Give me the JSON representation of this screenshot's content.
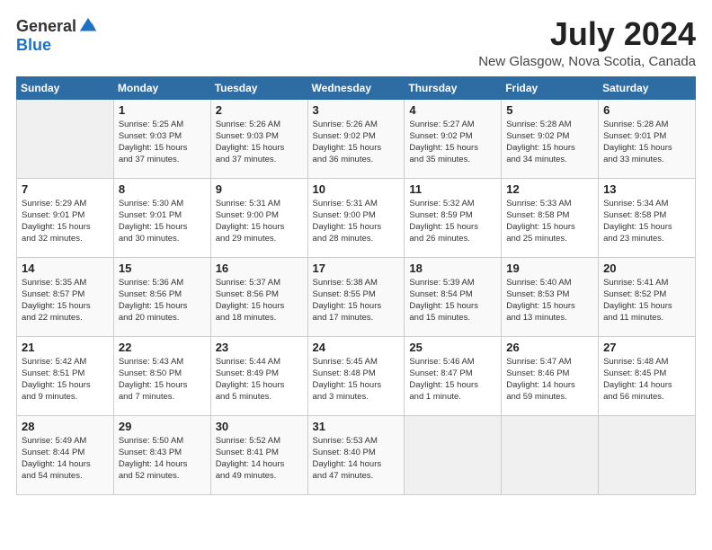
{
  "logo": {
    "general": "General",
    "blue": "Blue"
  },
  "title": "July 2024",
  "location": "New Glasgow, Nova Scotia, Canada",
  "weekdays": [
    "Sunday",
    "Monday",
    "Tuesday",
    "Wednesday",
    "Thursday",
    "Friday",
    "Saturday"
  ],
  "weeks": [
    [
      {
        "day": "",
        "info": ""
      },
      {
        "day": "1",
        "info": "Sunrise: 5:25 AM\nSunset: 9:03 PM\nDaylight: 15 hours\nand 37 minutes."
      },
      {
        "day": "2",
        "info": "Sunrise: 5:26 AM\nSunset: 9:03 PM\nDaylight: 15 hours\nand 37 minutes."
      },
      {
        "day": "3",
        "info": "Sunrise: 5:26 AM\nSunset: 9:02 PM\nDaylight: 15 hours\nand 36 minutes."
      },
      {
        "day": "4",
        "info": "Sunrise: 5:27 AM\nSunset: 9:02 PM\nDaylight: 15 hours\nand 35 minutes."
      },
      {
        "day": "5",
        "info": "Sunrise: 5:28 AM\nSunset: 9:02 PM\nDaylight: 15 hours\nand 34 minutes."
      },
      {
        "day": "6",
        "info": "Sunrise: 5:28 AM\nSunset: 9:01 PM\nDaylight: 15 hours\nand 33 minutes."
      }
    ],
    [
      {
        "day": "7",
        "info": "Sunrise: 5:29 AM\nSunset: 9:01 PM\nDaylight: 15 hours\nand 32 minutes."
      },
      {
        "day": "8",
        "info": "Sunrise: 5:30 AM\nSunset: 9:01 PM\nDaylight: 15 hours\nand 30 minutes."
      },
      {
        "day": "9",
        "info": "Sunrise: 5:31 AM\nSunset: 9:00 PM\nDaylight: 15 hours\nand 29 minutes."
      },
      {
        "day": "10",
        "info": "Sunrise: 5:31 AM\nSunset: 9:00 PM\nDaylight: 15 hours\nand 28 minutes."
      },
      {
        "day": "11",
        "info": "Sunrise: 5:32 AM\nSunset: 8:59 PM\nDaylight: 15 hours\nand 26 minutes."
      },
      {
        "day": "12",
        "info": "Sunrise: 5:33 AM\nSunset: 8:58 PM\nDaylight: 15 hours\nand 25 minutes."
      },
      {
        "day": "13",
        "info": "Sunrise: 5:34 AM\nSunset: 8:58 PM\nDaylight: 15 hours\nand 23 minutes."
      }
    ],
    [
      {
        "day": "14",
        "info": "Sunrise: 5:35 AM\nSunset: 8:57 PM\nDaylight: 15 hours\nand 22 minutes."
      },
      {
        "day": "15",
        "info": "Sunrise: 5:36 AM\nSunset: 8:56 PM\nDaylight: 15 hours\nand 20 minutes."
      },
      {
        "day": "16",
        "info": "Sunrise: 5:37 AM\nSunset: 8:56 PM\nDaylight: 15 hours\nand 18 minutes."
      },
      {
        "day": "17",
        "info": "Sunrise: 5:38 AM\nSunset: 8:55 PM\nDaylight: 15 hours\nand 17 minutes."
      },
      {
        "day": "18",
        "info": "Sunrise: 5:39 AM\nSunset: 8:54 PM\nDaylight: 15 hours\nand 15 minutes."
      },
      {
        "day": "19",
        "info": "Sunrise: 5:40 AM\nSunset: 8:53 PM\nDaylight: 15 hours\nand 13 minutes."
      },
      {
        "day": "20",
        "info": "Sunrise: 5:41 AM\nSunset: 8:52 PM\nDaylight: 15 hours\nand 11 minutes."
      }
    ],
    [
      {
        "day": "21",
        "info": "Sunrise: 5:42 AM\nSunset: 8:51 PM\nDaylight: 15 hours\nand 9 minutes."
      },
      {
        "day": "22",
        "info": "Sunrise: 5:43 AM\nSunset: 8:50 PM\nDaylight: 15 hours\nand 7 minutes."
      },
      {
        "day": "23",
        "info": "Sunrise: 5:44 AM\nSunset: 8:49 PM\nDaylight: 15 hours\nand 5 minutes."
      },
      {
        "day": "24",
        "info": "Sunrise: 5:45 AM\nSunset: 8:48 PM\nDaylight: 15 hours\nand 3 minutes."
      },
      {
        "day": "25",
        "info": "Sunrise: 5:46 AM\nSunset: 8:47 PM\nDaylight: 15 hours\nand 1 minute."
      },
      {
        "day": "26",
        "info": "Sunrise: 5:47 AM\nSunset: 8:46 PM\nDaylight: 14 hours\nand 59 minutes."
      },
      {
        "day": "27",
        "info": "Sunrise: 5:48 AM\nSunset: 8:45 PM\nDaylight: 14 hours\nand 56 minutes."
      }
    ],
    [
      {
        "day": "28",
        "info": "Sunrise: 5:49 AM\nSunset: 8:44 PM\nDaylight: 14 hours\nand 54 minutes."
      },
      {
        "day": "29",
        "info": "Sunrise: 5:50 AM\nSunset: 8:43 PM\nDaylight: 14 hours\nand 52 minutes."
      },
      {
        "day": "30",
        "info": "Sunrise: 5:52 AM\nSunset: 8:41 PM\nDaylight: 14 hours\nand 49 minutes."
      },
      {
        "day": "31",
        "info": "Sunrise: 5:53 AM\nSunset: 8:40 PM\nDaylight: 14 hours\nand 47 minutes."
      },
      {
        "day": "",
        "info": ""
      },
      {
        "day": "",
        "info": ""
      },
      {
        "day": "",
        "info": ""
      }
    ]
  ]
}
